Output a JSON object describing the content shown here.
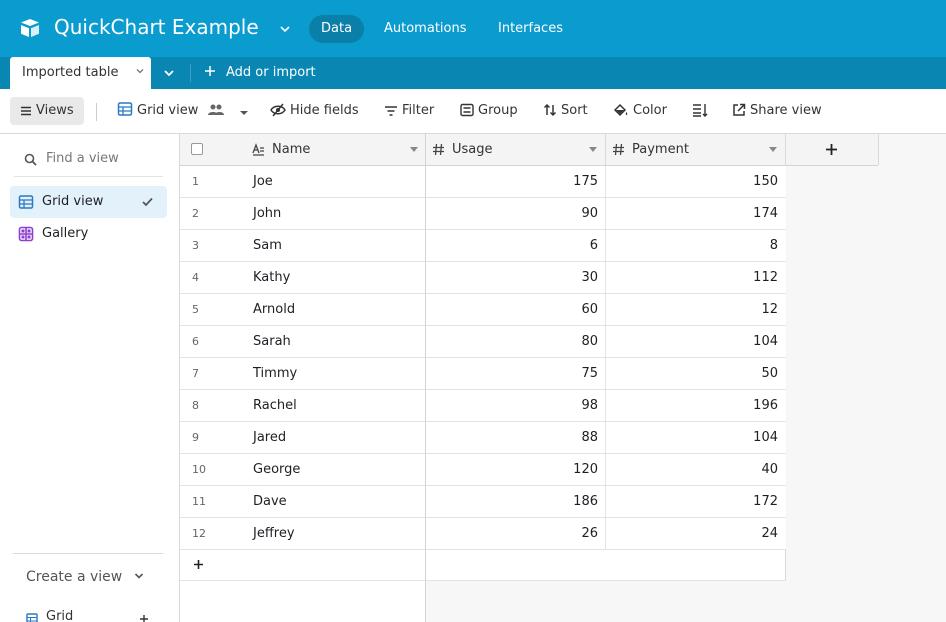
{
  "header": {
    "title": "QuickChart Example",
    "nav": [
      {
        "label": "Data"
      },
      {
        "label": "Automations"
      },
      {
        "label": "Interfaces"
      }
    ],
    "brand_color": "#0b9ccf"
  },
  "tabbar": {
    "active_tab": "Imported table",
    "add_import_label": "Add or import"
  },
  "toolbar": {
    "views_label": "Views",
    "view_name": "Grid view",
    "hide_fields_label": "Hide fields",
    "filter_label": "Filter",
    "group_label": "Group",
    "sort_label": "Sort",
    "color_label": "Color",
    "share_label": "Share view"
  },
  "sidebar": {
    "find_placeholder": "Find a view",
    "views": [
      {
        "label": "Grid view",
        "icon": "grid-icon",
        "active": true
      },
      {
        "label": "Gallery",
        "icon": "gallery-icon",
        "active": false
      }
    ],
    "create_view_label": "Create a view",
    "create_grid_label": "Grid"
  },
  "table": {
    "columns": [
      {
        "label": "Name",
        "icon": "text-field-icon"
      },
      {
        "label": "Usage",
        "icon": "number-field-icon"
      },
      {
        "label": "Payment",
        "icon": "number-field-icon"
      }
    ],
    "rows": [
      {
        "n": "1",
        "name": "Joe",
        "usage": "175",
        "payment": "150"
      },
      {
        "n": "2",
        "name": "John",
        "usage": "90",
        "payment": "174"
      },
      {
        "n": "3",
        "name": "Sam",
        "usage": "6",
        "payment": "8"
      },
      {
        "n": "4",
        "name": "Kathy",
        "usage": "30",
        "payment": "112"
      },
      {
        "n": "5",
        "name": "Arnold",
        "usage": "60",
        "payment": "12"
      },
      {
        "n": "6",
        "name": "Sarah",
        "usage": "80",
        "payment": "104"
      },
      {
        "n": "7",
        "name": "Timmy",
        "usage": "75",
        "payment": "50"
      },
      {
        "n": "8",
        "name": "Rachel",
        "usage": "98",
        "payment": "196"
      },
      {
        "n": "9",
        "name": "Jared",
        "usage": "88",
        "payment": "104"
      },
      {
        "n": "10",
        "name": "George",
        "usage": "120",
        "payment": "40"
      },
      {
        "n": "11",
        "name": "Dave",
        "usage": "186",
        "payment": "172"
      },
      {
        "n": "12",
        "name": "Jeffrey",
        "usage": "26",
        "payment": "24"
      }
    ]
  }
}
